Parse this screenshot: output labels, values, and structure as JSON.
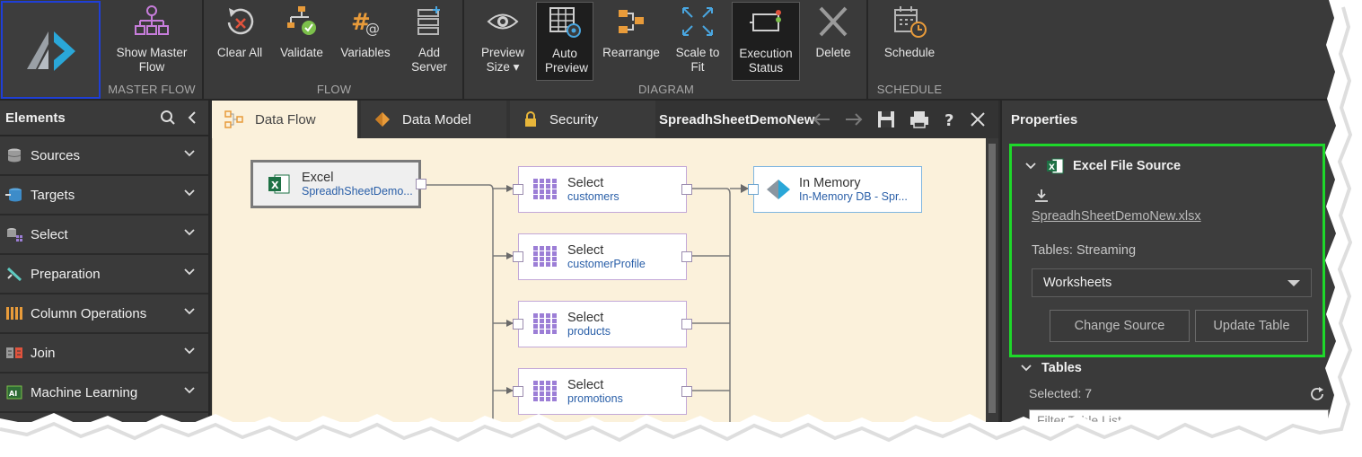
{
  "ribbon": {
    "groups": {
      "master_flow": "MASTER FLOW",
      "flow": "FLOW",
      "diagram": "DIAGRAM",
      "schedule": "SCHEDULE"
    },
    "buttons": {
      "show_master_flow": "Show Master Flow",
      "clear_all": "Clear All",
      "validate": "Validate",
      "variables": "Variables",
      "add_server": "Add Server",
      "preview_size": "Preview Size ▾",
      "auto_preview": "Auto Preview",
      "rearrange": "Rearrange",
      "scale_to_fit": "Scale to Fit",
      "execution_status": "Execution Status",
      "delete": "Delete",
      "schedule": "Schedule"
    }
  },
  "elements": {
    "title": "Elements",
    "categories": [
      {
        "label": "Sources",
        "icon": "database-icon"
      },
      {
        "label": "Targets",
        "icon": "target-database-icon"
      },
      {
        "label": "Select",
        "icon": "select-icon"
      },
      {
        "label": "Preparation",
        "icon": "wand-icon"
      },
      {
        "label": "Column Operations",
        "icon": "columns-icon"
      },
      {
        "label": "Join",
        "icon": "join-icon"
      },
      {
        "label": "Machine Learning",
        "icon": "ai-icon"
      }
    ]
  },
  "tabs": {
    "data_flow": "Data Flow",
    "data_model": "Data Model",
    "security": "Security",
    "document_name": "SpreadhSheetDemoNew"
  },
  "flow": {
    "source": {
      "title": "Excel",
      "subtitle": "SpreadhSheetDemo..."
    },
    "selects": [
      {
        "title": "Select",
        "subtitle": "customers"
      },
      {
        "title": "Select",
        "subtitle": "customerProfile"
      },
      {
        "title": "Select",
        "subtitle": "products"
      },
      {
        "title": "Select",
        "subtitle": "promotions"
      }
    ],
    "target": {
      "title": "In Memory",
      "subtitle": "In-Memory DB - Spr..."
    }
  },
  "properties": {
    "title": "Properties",
    "section_title": "Excel File Source",
    "file_link": "SpreadhSheetDemoNew.xlsx",
    "tables_label": "Tables: Streaming",
    "dropdown_value": "Worksheets",
    "change_source": "Change Source",
    "update_table": "Update Table",
    "tables_section": "Tables",
    "selected_count": "Selected: 7",
    "filter_placeholder": "Filter Table List"
  },
  "colors": {
    "highlight_border": "#1ed82a",
    "logo_border": "#1f3fd6",
    "canvas_bg": "#fbf1db",
    "link_blue": "#2a5fa8"
  }
}
